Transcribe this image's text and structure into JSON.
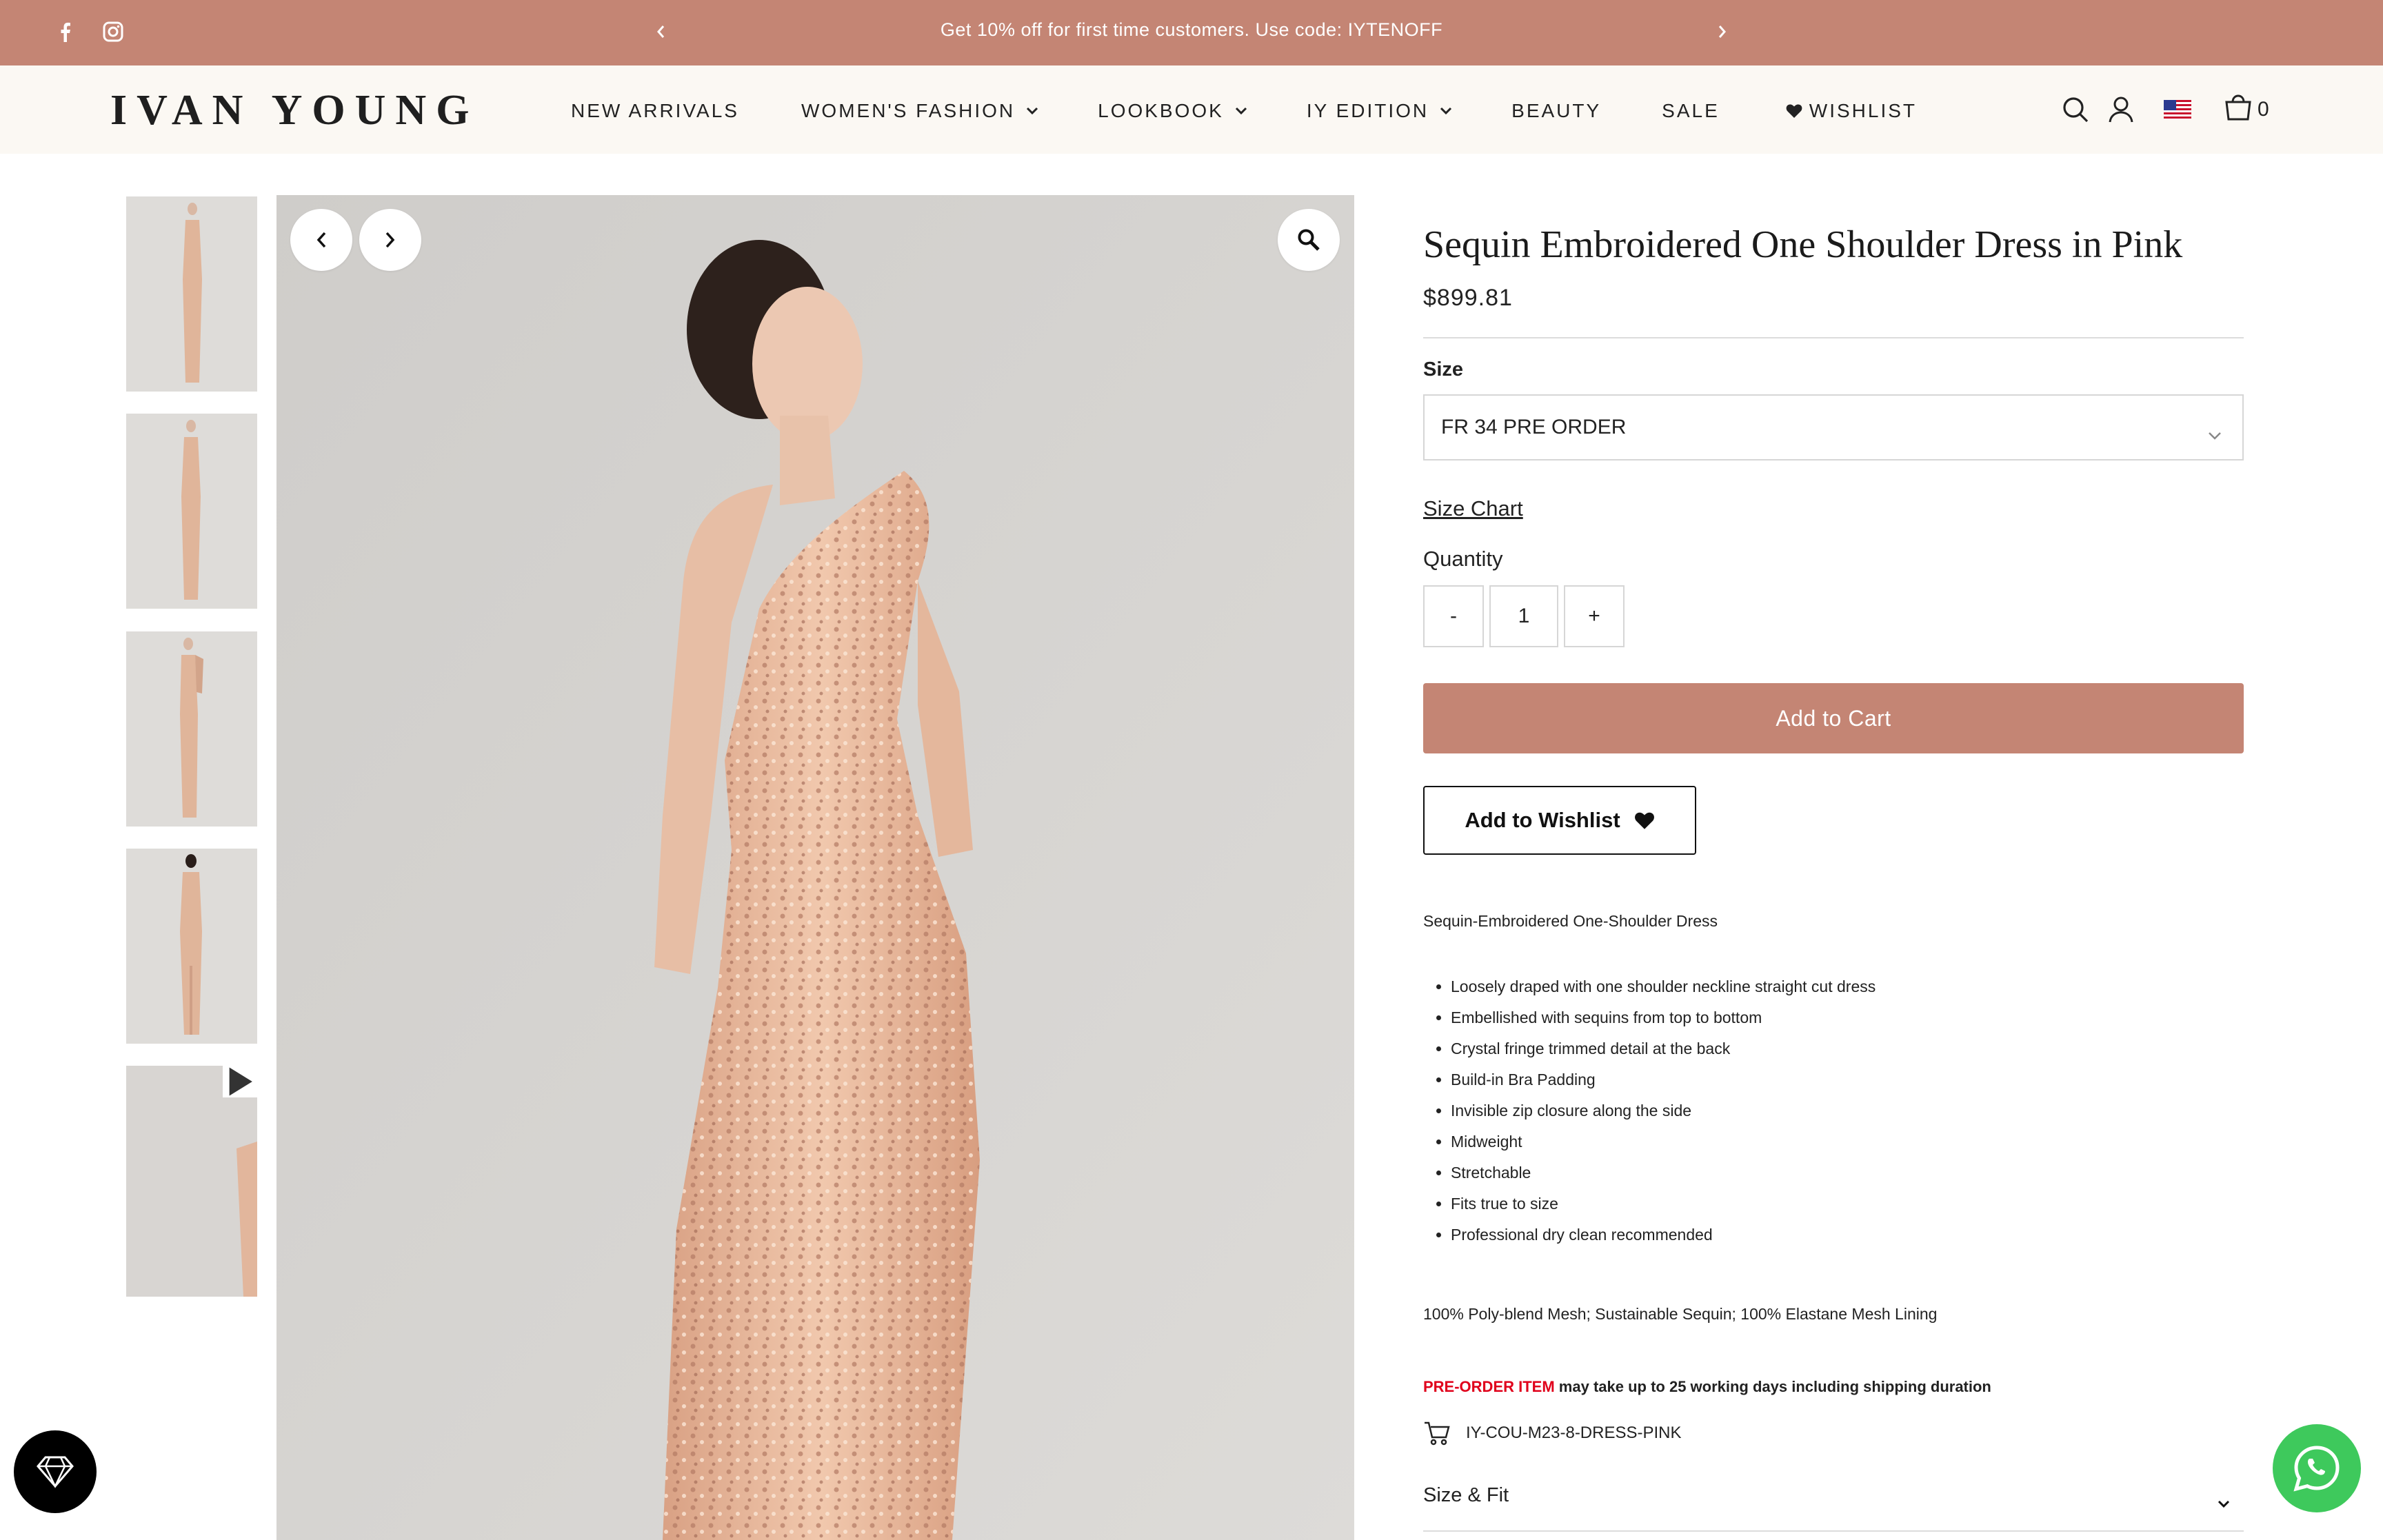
{
  "announcement": {
    "message": "Get 10% off for first time customers. Use code: IYTENOFF",
    "prev_glyph": "‹",
    "next_glyph": "›",
    "social_icons": [
      "facebook-icon",
      "instagram-icon"
    ]
  },
  "header": {
    "logo": "IVAN YOUNG",
    "nav": [
      {
        "label": "NEW ARRIVALS",
        "has_dropdown": false
      },
      {
        "label": "WOMEN'S FASHION",
        "has_dropdown": true
      },
      {
        "label": "LOOKBOOK",
        "has_dropdown": true
      },
      {
        "label": "IY EDITION",
        "has_dropdown": true
      },
      {
        "label": "BEAUTY",
        "has_dropdown": false
      },
      {
        "label": "SALE",
        "has_dropdown": false
      },
      {
        "label": "WISHLIST",
        "has_dropdown": false,
        "icon": "heart-icon"
      }
    ],
    "cart_count": "0",
    "icons": [
      "search-icon",
      "account-icon",
      "us-flag-icon",
      "cart-bag-icon"
    ]
  },
  "gallery": {
    "thumbnail_count": 5,
    "last_thumbnail_is_video": true
  },
  "product": {
    "title": "Sequin Embroidered One Shoulder Dress in Pink",
    "price": "$899.81",
    "size_label": "Size",
    "size_selected": "FR 34 PRE ORDER",
    "size_chart_link": "Size Chart",
    "quantity_label": "Quantity",
    "qty_minus": "-",
    "qty_value": "1",
    "qty_plus": "+",
    "add_to_cart": "Add to Cart",
    "add_to_wishlist": "Add to Wishlist",
    "description_intro": "Sequin-Embroidered One-Shoulder Dress",
    "features": [
      "Loosely draped with one shoulder neckline straight cut dress",
      "Embellished with sequins from top to bottom",
      "Crystal fringe trimmed detail at the back",
      "Build-in Bra Padding",
      "Invisible zip closure along the side",
      "Midweight",
      "Stretchable",
      "Fits true to size",
      "Professional dry clean recommended"
    ],
    "material": "100% Poly-blend Mesh; Sustainable Sequin; 100% Elastane Mesh Lining",
    "preorder_tag": "PRE-ORDER ITEM",
    "preorder_text": " may take up to 25 working days including shipping duration",
    "sku": "IY-COU-M23-8-DRESS-PINK",
    "size_fit_label": "Size & Fit"
  },
  "colors": {
    "brand": "#c48574",
    "header_bg": "#fbf8f3",
    "preorder_red": "#e0001b",
    "whatsapp": "#3ec95c"
  }
}
